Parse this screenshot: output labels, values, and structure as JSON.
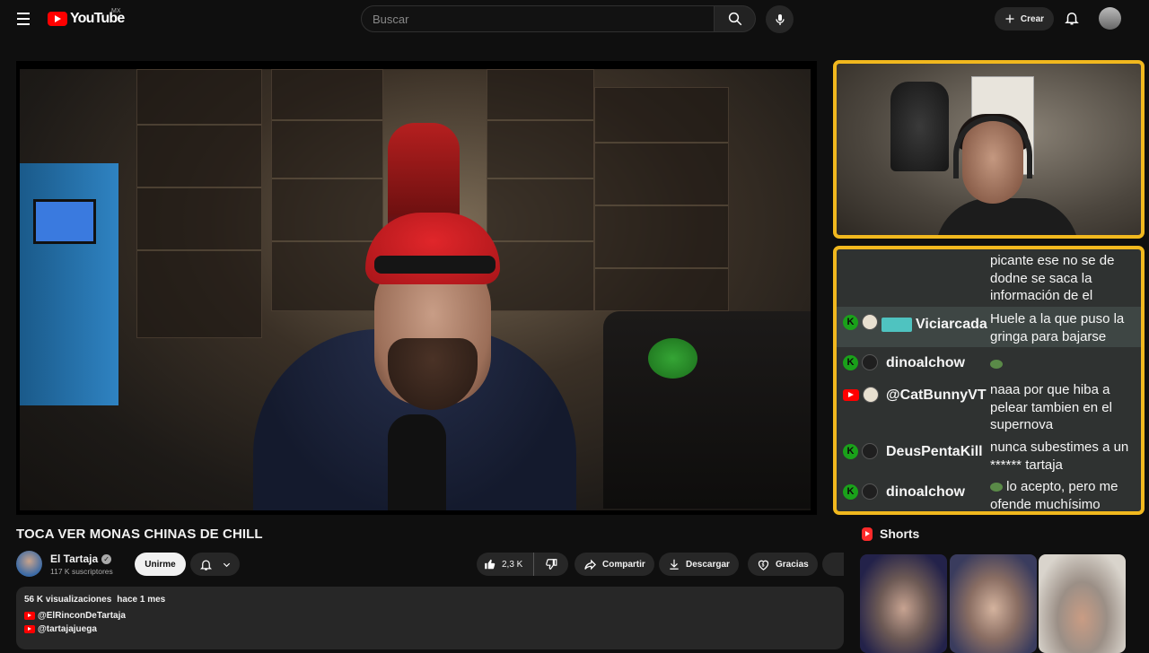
{
  "header": {
    "logo_text": "YouTube",
    "region": "MX",
    "search_placeholder": "Buscar",
    "create_label": "Crear",
    "icons": [
      "menu-icon",
      "search-icon",
      "mic-icon",
      "plus-icon",
      "bell-icon"
    ]
  },
  "video": {
    "title": "TOCA VER MONAS CHINAS DE CHILL"
  },
  "channel": {
    "name": "El Tartaja",
    "subscribers": "117 K suscriptores",
    "join_label": "Unirme"
  },
  "actions": {
    "likes": "2,3 K",
    "share_label": "Compartir",
    "download_label": "Descargar",
    "thanks_label": "Gracias"
  },
  "description": {
    "views": "56 K visualizaciones",
    "date": "hace 1 mes",
    "links": [
      "@ElRinconDeTartaja",
      "@tartajajuega"
    ]
  },
  "chat": {
    "messages": [
      {
        "user": "",
        "text": "picante ese no se de dodne se saca la información de el",
        "platform": "kick"
      },
      {
        "user": "Viciarcada",
        "text": "Huele a la que puso la gringa para bajarse",
        "platform": "kick",
        "highlight": true
      },
      {
        "user": "dinoalchow",
        "text": "",
        "platform": "kick"
      },
      {
        "user": "@CatBunnyVT",
        "text": "naaa por que hiba a pelear tambien en el supernova",
        "platform": "youtube"
      },
      {
        "user": "DeusPentaKill",
        "text": "nunca subestimes a un ****** tartaja",
        "platform": "kick"
      },
      {
        "user": "dinoalchow",
        "text": "lo acepto, pero me ofende muchísimo",
        "platform": "kick"
      }
    ],
    "accent_color": "#f1b81e"
  },
  "shorts": {
    "heading": "Shorts"
  }
}
